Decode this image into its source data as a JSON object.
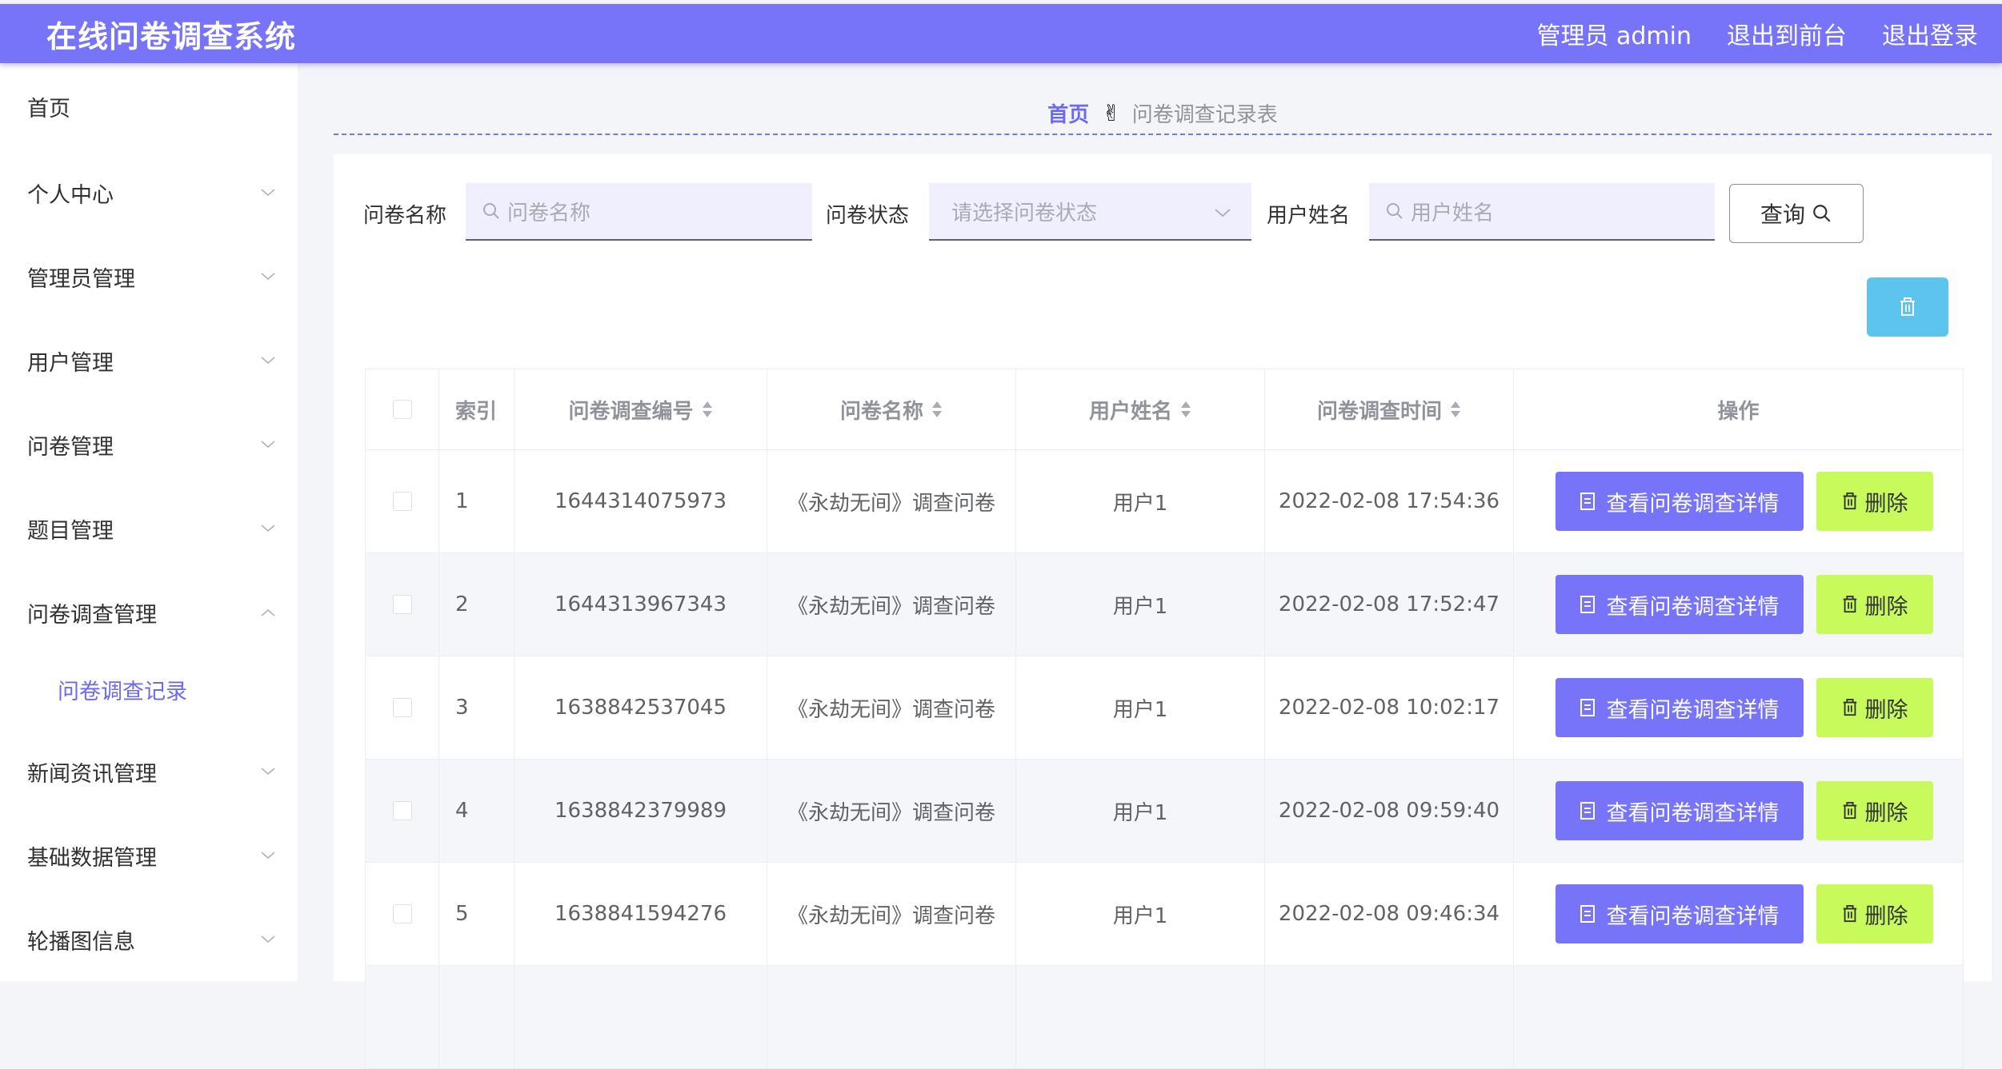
{
  "header": {
    "title": "在线问卷调查系统",
    "links": [
      "管理员 admin",
      "退出到前台",
      "退出登录"
    ]
  },
  "sidebar": {
    "items": [
      {
        "label": "首页",
        "chevron": "none"
      },
      {
        "label": "个人中心",
        "chevron": "down"
      },
      {
        "label": "管理员管理",
        "chevron": "down"
      },
      {
        "label": "用户管理",
        "chevron": "down"
      },
      {
        "label": "问卷管理",
        "chevron": "down"
      },
      {
        "label": "题目管理",
        "chevron": "down"
      },
      {
        "label": "问卷调查管理",
        "chevron": "up"
      },
      {
        "label": "问卷调查记录",
        "chevron": "none",
        "sub": true,
        "active": true
      },
      {
        "label": "新闻资讯管理",
        "chevron": "down"
      },
      {
        "label": "基础数据管理",
        "chevron": "down"
      },
      {
        "label": "轮播图信息",
        "chevron": "down"
      }
    ]
  },
  "breadcrumb": {
    "home": "首页",
    "separator_icon": "hand-icon",
    "current": "问卷调查记录表"
  },
  "filters": {
    "survey_name_label": "问卷名称",
    "survey_name_placeholder": "问卷名称",
    "survey_status_label": "问卷状态",
    "survey_status_placeholder": "请选择问卷状态",
    "user_name_label": "用户姓名",
    "user_name_placeholder": "用户姓名",
    "query_label": "查询"
  },
  "table": {
    "headers": {
      "index": "索引",
      "record_no": "问卷调查编号",
      "survey_name": "问卷名称",
      "user_name": "用户姓名",
      "survey_time": "问卷调查时间",
      "ops": "操作"
    },
    "view_label": "查看问卷调查详情",
    "delete_label": "删除",
    "rows": [
      {
        "index": "1",
        "record_no": "1644314075973",
        "survey_name": "《永劫无间》调查问卷",
        "user_name": "用户1",
        "survey_time": "2022-02-08 17:54:36"
      },
      {
        "index": "2",
        "record_no": "1644313967343",
        "survey_name": "《永劫无间》调查问卷",
        "user_name": "用户1",
        "survey_time": "2022-02-08 17:52:47"
      },
      {
        "index": "3",
        "record_no": "1638842537045",
        "survey_name": "《永劫无间》调查问卷",
        "user_name": "用户1",
        "survey_time": "2022-02-08 10:02:17"
      },
      {
        "index": "4",
        "record_no": "1638842379989",
        "survey_name": "《永劫无间》调查问卷",
        "user_name": "用户1",
        "survey_time": "2022-02-08 09:59:40"
      },
      {
        "index": "5",
        "record_no": "1638841594276",
        "survey_name": "《永劫无间》调查问卷",
        "user_name": "用户1",
        "survey_time": "2022-02-08 09:46:34"
      },
      {
        "index": "",
        "record_no": "",
        "survey_name": "",
        "user_name": "",
        "survey_time": ""
      }
    ]
  },
  "colors": {
    "primary": "#7774fa",
    "delete_green": "#c8fa5c",
    "bulk_delete_blue": "#5dc4ef"
  }
}
